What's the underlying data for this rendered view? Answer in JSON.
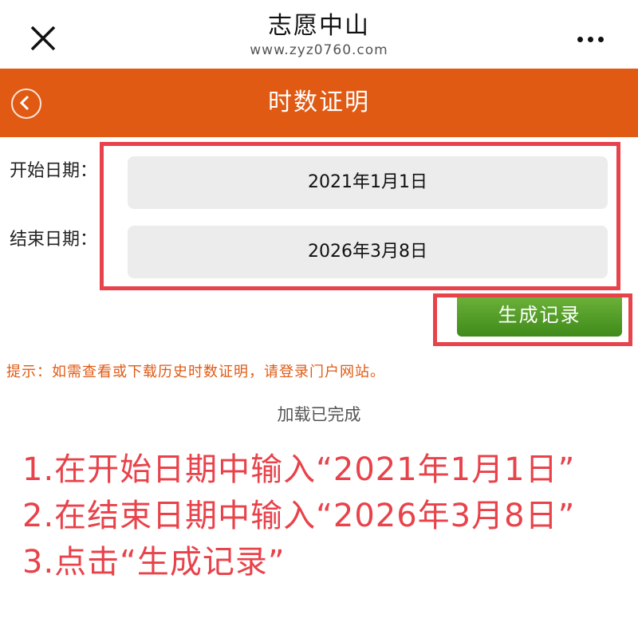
{
  "window": {
    "title": "志愿中山",
    "url": "www.zyz0760.com",
    "close_icon": "close-icon",
    "more_icon": "more-icon"
  },
  "nav": {
    "title": "时数证明",
    "back_icon": "back-circle-icon"
  },
  "form": {
    "start_label": "开始日期：",
    "start_value": "2021年1月1日",
    "end_label": "结束日期：",
    "end_value": "2026年3月8日",
    "generate_button": "生成记录"
  },
  "tip": "提示：如需查看或下载历史时数证明，请登录门户网站。",
  "status": "加载已完成",
  "instructions": [
    "1.在开始日期中输入“2021年1月1日”",
    "2.在结束日期中输入“2026年3月8日”",
    "3.点击“生成记录”"
  ],
  "colors": {
    "nav_bg": "#e05a14",
    "highlight_box": "#e8424a",
    "button_green": "#4f9a25",
    "annotation_text": "#e8424a"
  }
}
